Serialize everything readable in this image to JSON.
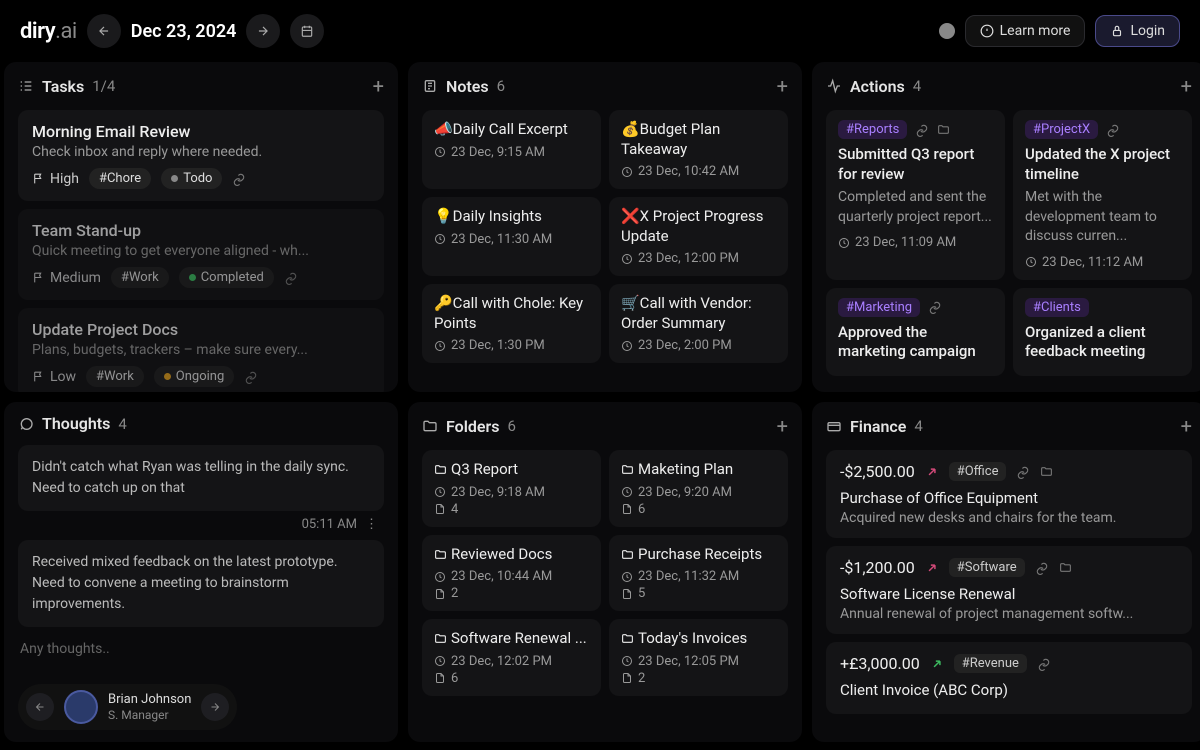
{
  "app": {
    "name": "diry",
    "suffix": ".ai"
  },
  "date": "Dec 23, 2024",
  "nav": {
    "learn": "Learn more",
    "login": "Login"
  },
  "tasks": {
    "title": "Tasks",
    "count": "1/4",
    "items": [
      {
        "title": "Morning Email Review",
        "sub": "Check inbox and reply where needed.",
        "prio": "High",
        "tag": "#Chore",
        "status": "Todo",
        "statusDot": "gray"
      },
      {
        "title": "Team Stand-up",
        "sub": "Quick meeting to get everyone aligned - wh...",
        "prio": "Medium",
        "tag": "#Work",
        "status": "Completed",
        "statusDot": "green"
      },
      {
        "title": "Update Project Docs",
        "sub": "Plans, budgets, trackers – make sure every...",
        "prio": "Low",
        "tag": "#Work",
        "status": "Ongoing",
        "statusDot": "orange"
      }
    ]
  },
  "notes": {
    "title": "Notes",
    "count": "6",
    "items": [
      {
        "title": "📣Daily Call Excerpt",
        "time": "23 Dec, 9:15 AM"
      },
      {
        "title": "💰Budget Plan Takeaway",
        "time": "23 Dec, 10:42 AM"
      },
      {
        "title": "💡Daily Insights",
        "time": "23 Dec, 11:30 AM"
      },
      {
        "title": "❌X Project Progress Update",
        "time": "23 Dec, 12:00 PM"
      },
      {
        "title": "🔑Call with Chole: Key Points",
        "time": "23 Dec, 1:30 PM"
      },
      {
        "title": "🛒Call with Vendor: Order Summary",
        "time": "23 Dec, 2:00 PM"
      }
    ]
  },
  "actions": {
    "title": "Actions",
    "count": "4",
    "items": [
      {
        "chip": "#Reports",
        "title": "Submitted Q3 report for review",
        "desc": "Completed and sent the quarterly project report...",
        "time": "23 Dec, 11:09 AM",
        "icons": "lf"
      },
      {
        "chip": "#ProjectX",
        "title": "Updated the X project timeline",
        "desc": "Met with the development team to discuss curren...",
        "time": "23 Dec, 11:12 AM",
        "icons": "l"
      },
      {
        "chip": "#Marketing",
        "title": "Approved the marketing campaign",
        "desc": "",
        "time": "",
        "icons": "l"
      },
      {
        "chip": "#Clients",
        "title": "Organized a client feedback meeting",
        "desc": "",
        "time": "",
        "icons": ""
      }
    ]
  },
  "thoughts": {
    "title": "Thoughts",
    "count": "4",
    "items": [
      {
        "text": "Didn't catch what Ryan was telling in the daily sync. Need to catch up on that",
        "time": "05:11 AM"
      },
      {
        "text": "Received mixed feedback on the latest prototype. Need to convene a meeting to brainstorm improvements.",
        "time": ""
      }
    ],
    "placeholder": "Any thoughts..",
    "user": {
      "name": "Brian Johnson",
      "role": "S. Manager"
    }
  },
  "folders": {
    "title": "Folders",
    "count": "6",
    "items": [
      {
        "title": "Q3 Report",
        "time": "23 Dec, 9:18 AM",
        "files": "4"
      },
      {
        "title": "Maketing Plan",
        "time": "23 Dec, 9:20 AM",
        "files": "6"
      },
      {
        "title": "Reviewed Docs",
        "time": "23 Dec, 10:44 AM",
        "files": "2"
      },
      {
        "title": "Purchase Receipts",
        "time": "23 Dec, 11:32 AM",
        "files": "5"
      },
      {
        "title": "Software Renewal ...",
        "time": "23 Dec, 12:02 PM",
        "files": "6"
      },
      {
        "title": "Today's Invoices",
        "time": "23 Dec, 12:05 PM",
        "files": "2"
      }
    ]
  },
  "finance": {
    "title": "Finance",
    "count": "4",
    "items": [
      {
        "amt": "-$2,500.00",
        "pos": false,
        "tag": "#Office",
        "title": "Purchase of Office Equipment",
        "desc": "Acquired new desks and chairs for the team.",
        "icons": "lf"
      },
      {
        "amt": "-$1,200.00",
        "pos": false,
        "tag": "#Software",
        "title": "Software License Renewal",
        "desc": "Annual renewal of project management softw...",
        "icons": "lf"
      },
      {
        "amt": "+£3,000.00",
        "pos": true,
        "tag": "#Revenue",
        "title": "Client Invoice (ABC Corp)",
        "desc": "",
        "icons": "l"
      }
    ]
  }
}
